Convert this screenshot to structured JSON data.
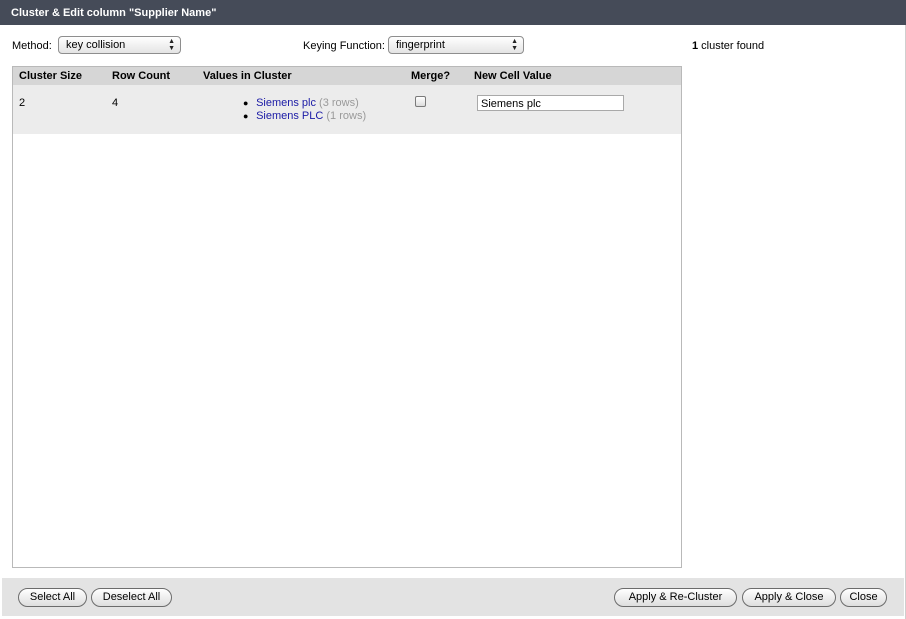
{
  "dialog": {
    "title": "Cluster & Edit column \"Supplier Name\""
  },
  "toolbar": {
    "method_label": "Method:",
    "method_value": "key collision",
    "keying_label": "Keying Function:",
    "keying_value": "fingerprint",
    "status_count": "1",
    "status_text": " cluster found"
  },
  "table": {
    "headers": [
      "Cluster Size",
      "Row Count",
      "Values in Cluster",
      "Merge?",
      "New Cell Value"
    ],
    "rows": [
      {
        "cluster_size": "2",
        "row_count": "4",
        "values": [
          {
            "name": "Siemens plc",
            "rows": "(3 rows)"
          },
          {
            "name": "Siemens PLC",
            "rows": "(1 rows)"
          }
        ],
        "merge": false,
        "new_value": "Siemens plc"
      }
    ]
  },
  "footer": {
    "select_all": "Select All",
    "deselect_all": "Deselect All",
    "apply_recluster": "Apply & Re-Cluster",
    "apply_close": "Apply & Close",
    "close": "Close"
  }
}
